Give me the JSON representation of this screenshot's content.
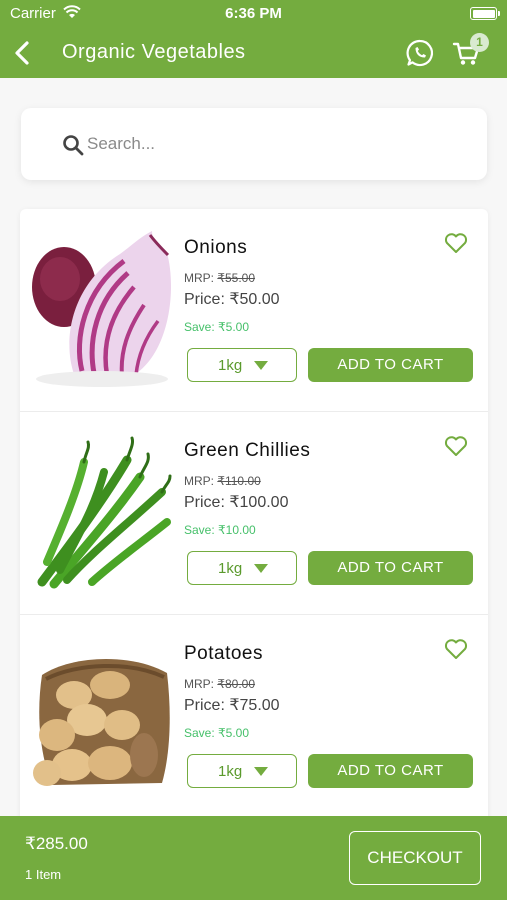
{
  "status_bar": {
    "carrier": "Carrier",
    "time": "6:36 PM"
  },
  "nav": {
    "title": "Organic Vegetables",
    "cart_badge": "1",
    "icons": {
      "back": "back-arrow-icon",
      "whatsapp": "whatsapp-icon",
      "cart": "cart-icon"
    }
  },
  "search": {
    "placeholder": "Search...",
    "value": ""
  },
  "products": [
    {
      "name": "Onions",
      "mrp_label": "MRP:",
      "mrp": "₹55.00",
      "price": "Price: ₹50.00",
      "save": "Save: ₹5.00",
      "qty": "1kg",
      "add_label": "ADD TO CART",
      "image": "onion"
    },
    {
      "name": "Green Chillies",
      "mrp_label": "MRP:",
      "mrp": "₹110.00",
      "price": "Price: ₹100.00",
      "save": "Save: ₹10.00",
      "qty": "1kg",
      "add_label": "ADD TO CART",
      "image": "green-chillies"
    },
    {
      "name": "Potatoes",
      "mrp_label": "MRP:",
      "mrp": "₹80.00",
      "price": "Price: ₹75.00",
      "save": "Save: ₹5.00",
      "qty": "1kg",
      "add_label": "ADD TO CART",
      "image": "potatoes"
    }
  ],
  "footer": {
    "total": "₹285.00",
    "items": "1 Item",
    "checkout_label": "CHECKOUT"
  },
  "colors": {
    "brand": "#74ac3f",
    "save": "#46c06a",
    "text": "#111111"
  }
}
